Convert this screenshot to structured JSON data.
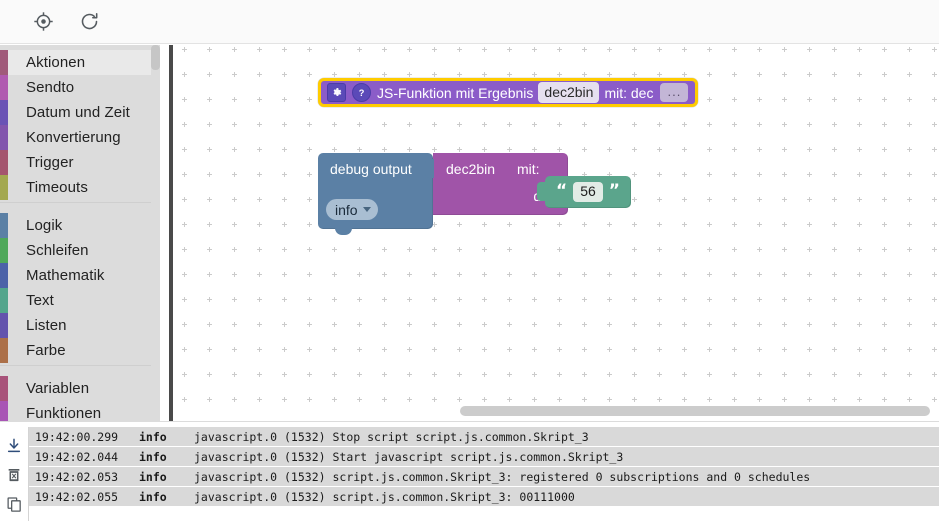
{
  "toolbar": {
    "buttons": [
      {
        "name": "center-blocks-button",
        "icon": "crosshair-target-icon",
        "title": "Zentrieren"
      },
      {
        "name": "reload-button",
        "icon": "refresh-icon",
        "title": "Neu laden"
      }
    ]
  },
  "sidebar": {
    "items": [
      {
        "label": "Aktionen",
        "color": "#a05a7a",
        "selected": true,
        "gap_before": false
      },
      {
        "label": "Sendto",
        "color": "#b05ab0",
        "selected": false,
        "gap_before": false
      },
      {
        "label": "Datum und Zeit",
        "color": "#6a53b5",
        "selected": false,
        "gap_before": false
      },
      {
        "label": "Konvertierung",
        "color": "#8255ad",
        "selected": false,
        "gap_before": false
      },
      {
        "label": "Trigger",
        "color": "#a4556e",
        "selected": false,
        "gap_before": false
      },
      {
        "label": "Timeouts",
        "color": "#a3a84f",
        "selected": false,
        "gap_before": false
      },
      {
        "label": "Logik",
        "color": "#5b80a5",
        "selected": false,
        "gap_before": true
      },
      {
        "label": "Schleifen",
        "color": "#4fa85a",
        "selected": false,
        "gap_before": false
      },
      {
        "label": "Mathematik",
        "color": "#4c62a8",
        "selected": false,
        "gap_before": false
      },
      {
        "label": "Text",
        "color": "#53a58c",
        "selected": false,
        "gap_before": false
      },
      {
        "label": "Listen",
        "color": "#6353ad",
        "selected": false,
        "gap_before": false
      },
      {
        "label": "Farbe",
        "color": "#ac7049",
        "selected": false,
        "gap_before": false
      },
      {
        "label": "Variablen",
        "color": "#a8537a",
        "selected": false,
        "gap_before": true
      },
      {
        "label": "Funktionen",
        "color": "#a855b5",
        "selected": false,
        "gap_before": false
      }
    ]
  },
  "workspace": {
    "blocks": {
      "function_definition": {
        "text": "JS-Funktion mit Ergebnis",
        "name_field": "dec2bin",
        "with_label": "mit: dec",
        "more_field": "...",
        "color": "#8b5cc8",
        "selected_outline": "#ffcc00",
        "gear_icon": "gear-icon",
        "help_icon": "help-icon"
      },
      "debug_output": {
        "label": "debug output",
        "severity": "info",
        "color": "#5b80a5"
      },
      "function_call": {
        "name": "dec2bin",
        "with_label": "mit:",
        "arg_label": "dec",
        "color": "#a054a8"
      },
      "text_string": {
        "value": "56",
        "open_quote": "“",
        "close_quote": "”",
        "color": "#5ba58c"
      }
    }
  },
  "log": {
    "tools": [
      {
        "name": "scroll-to-bottom-icon",
        "title": "Nach unten scrollen"
      },
      {
        "name": "clear-log-icon",
        "title": "Log leeren"
      },
      {
        "name": "copy-log-icon",
        "title": "Kopieren"
      }
    ],
    "rows": [
      {
        "time": "19:42:00.299",
        "severity": "info",
        "message": "javascript.0 (1532) Stop script script.js.common.Skript_3"
      },
      {
        "time": "19:42:02.044",
        "severity": "info",
        "message": "javascript.0 (1532) Start javascript script.js.common.Skript_3"
      },
      {
        "time": "19:42:02.053",
        "severity": "info",
        "message": "javascript.0 (1532) script.js.common.Skript_3: registered 0 subscriptions and 0 schedules"
      },
      {
        "time": "19:42:02.055",
        "severity": "info",
        "message": "javascript.0 (1532) script.js.common.Skript_3: 00111000"
      }
    ]
  }
}
